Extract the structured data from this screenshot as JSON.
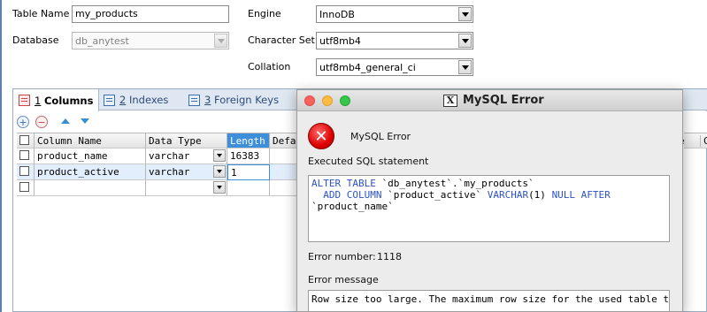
{
  "form": {
    "table_name_label": "Table Name",
    "table_name_value": "my_products",
    "database_label": "Database",
    "database_value": "db_anytest",
    "engine_label": "Engine",
    "engine_value": "InnoDB",
    "charset_label": "Character Set",
    "charset_value": "utf8mb4",
    "collation_label": "Collation",
    "collation_value": "utf8mb4_general_ci"
  },
  "tabs": [
    {
      "num": "1",
      "label": "Columns"
    },
    {
      "num": "2",
      "label": "Indexes"
    },
    {
      "num": "3",
      "label": "Foreign Keys"
    }
  ],
  "grid": {
    "headers": [
      "Column Name",
      "Data Type",
      "Length",
      "Defa"
    ],
    "right_headers": [
      "e",
      "C"
    ],
    "rows": [
      {
        "name": "product_name",
        "type": "varchar",
        "length": "16383"
      },
      {
        "name": "product_active",
        "type": "varchar",
        "length": "1"
      },
      {
        "name": "",
        "type": "",
        "length": ""
      }
    ]
  },
  "dialog": {
    "window_title": "MySQL Error",
    "heading": "MySQL Error",
    "executed_label": "Executed  SQL statement",
    "sql": {
      "kw1": "ALTER TABLE",
      "t1": " `db_anytest`.`my_products`",
      "kw2": "  ADD COLUMN",
      "t2": " `product_active` ",
      "kw3": "VARCHAR",
      "t3": "(1) ",
      "kw4": "NULL AFTER",
      "t4": "`product_name`"
    },
    "error_number_label": "Error number:",
    "error_number": "1118",
    "error_message_label": "Error message",
    "error_message": "Row size too large. The maximum row size for the used table type, not"
  }
}
